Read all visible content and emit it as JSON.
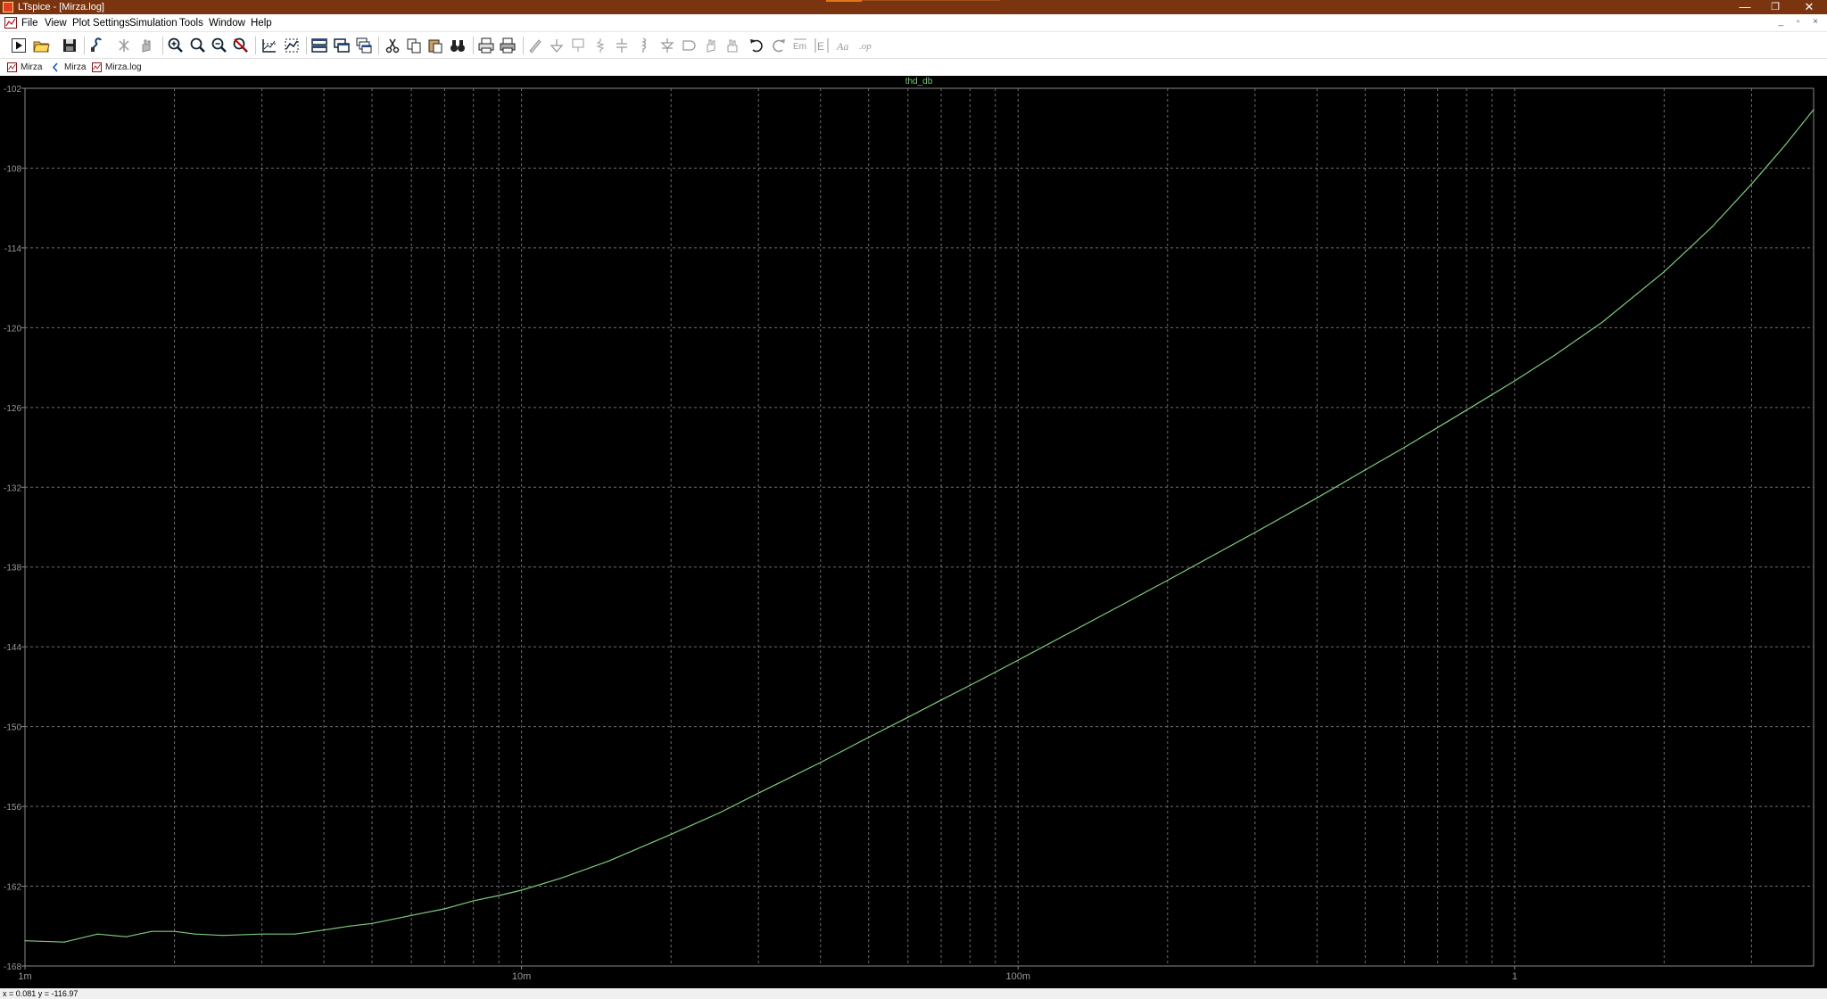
{
  "window": {
    "title": "LTspice - [Mirza.log]",
    "minimize": "—",
    "restore": "❐",
    "close": "✕"
  },
  "menu": {
    "items": [
      "File",
      "View",
      "Plot Settings",
      "Simulation",
      "Tools",
      "Window",
      "Help"
    ]
  },
  "toolbar": {
    "buttons": [
      "run",
      "open",
      "save",
      "control-panel",
      "halt",
      "pan",
      "zoom-in",
      "zoom-box",
      "zoom-out",
      "zoom-cancel",
      "autorange",
      "mark-data",
      "tile-horizontal",
      "tile-vertical",
      "cascade",
      "cut",
      "copy",
      "paste",
      "find",
      "print",
      "print-preview",
      "wire",
      "ground",
      "label",
      "resistor",
      "capacitor",
      "inductor",
      "diode",
      "component",
      "move",
      "drag",
      "undo",
      "redo",
      "rotate",
      "mirror",
      "text",
      "spice-directive"
    ]
  },
  "tabs": [
    {
      "label": "Mirza",
      "icon": "schematic-icon"
    },
    {
      "label": "Mirza",
      "icon": "netlist-icon"
    },
    {
      "label": "Mirza.log",
      "icon": "log-icon"
    }
  ],
  "status": {
    "text": "x = 0.081    y = -116.97"
  },
  "colors": {
    "titlebar": "#7a3510",
    "plot_background": "#000000",
    "trace": "#7ecb7e",
    "grid": "#6e6e6e"
  },
  "chart_data": {
    "type": "line",
    "title": "thd_db",
    "x_scale": "log",
    "xlim": [
      0.001,
      4
    ],
    "ylim": [
      -168,
      -102
    ],
    "x_ticks": [
      {
        "value": 0.001,
        "label": "1m"
      },
      {
        "value": 0.01,
        "label": "10m"
      },
      {
        "value": 0.1,
        "label": "100m"
      },
      {
        "value": 1,
        "label": "1"
      }
    ],
    "y_ticks": [
      -102,
      -108,
      -114,
      -120,
      -126,
      -132,
      -138,
      -144,
      -150,
      -156,
      -162,
      -168
    ],
    "y_tick_labels": [
      "-102",
      "-108",
      "-114",
      "-120",
      "-126",
      "-132",
      "-138",
      "-144",
      "-150",
      "-156",
      "-162",
      "-168"
    ],
    "grid": true,
    "series": [
      {
        "color": "#7ecb7e",
        "x": [
          0.001,
          0.0012,
          0.0014,
          0.0016,
          0.0018,
          0.002,
          0.0022,
          0.0025,
          0.003,
          0.0035,
          0.004,
          0.0045,
          0.005,
          0.006,
          0.007,
          0.008,
          0.009,
          0.01,
          0.012,
          0.015,
          0.02,
          0.025,
          0.03,
          0.04,
          0.05,
          0.06,
          0.07,
          0.08,
          0.09,
          0.1,
          0.15,
          0.2,
          0.3,
          0.4,
          0.5,
          0.6,
          0.7,
          0.8,
          1.0,
          1.2,
          1.5,
          2.0,
          2.5,
          3.0,
          3.5,
          4.0
        ],
        "y": [
          -166.1,
          -166.2,
          -165.6,
          -165.8,
          -165.4,
          -165.4,
          -165.6,
          -165.7,
          -165.6,
          -165.6,
          -165.3,
          -165.0,
          -164.8,
          -164.2,
          -163.7,
          -163.1,
          -162.7,
          -162.3,
          -161.4,
          -160.1,
          -158.1,
          -156.5,
          -155.0,
          -152.7,
          -150.8,
          -149.3,
          -148.0,
          -146.9,
          -145.9,
          -145.0,
          -141.5,
          -139.0,
          -135.4,
          -132.8,
          -130.7,
          -129.0,
          -127.5,
          -126.2,
          -124.0,
          -122.1,
          -119.6,
          -115.8,
          -112.4,
          -109.2,
          -106.3,
          -103.6
        ]
      }
    ]
  }
}
